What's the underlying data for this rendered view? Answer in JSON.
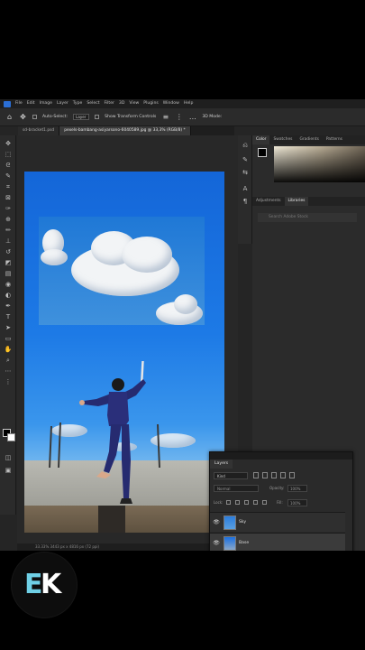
{
  "menubar": {
    "items": [
      "File",
      "Edit",
      "Image",
      "Layer",
      "Type",
      "Select",
      "Filter",
      "3D",
      "View",
      "Plugins",
      "Window",
      "Help"
    ]
  },
  "options_bar": {
    "auto_select_label": "Auto-Select:",
    "auto_select_value": "Layer",
    "transform_controls_label": "Show Transform Controls",
    "mode_3d_label": "3D Mode:"
  },
  "document_tabs": [
    {
      "label": "sd-bracket1.psd",
      "active": false
    },
    {
      "label": "pexels-bambang-asiyarsono-6040589.jpg @ 33,3% (RGB/8) *",
      "active": true
    }
  ],
  "canvas_status": "33.33%   3443 px x 4816 px (72 ppi)",
  "color_panel": {
    "tabs": [
      {
        "label": "Color",
        "active": true
      },
      {
        "label": "Swatches",
        "active": false
      },
      {
        "label": "Gradients",
        "active": false
      },
      {
        "label": "Patterns",
        "active": false
      }
    ],
    "foreground_color": "#000000"
  },
  "adjust_panel": {
    "tabs": [
      {
        "label": "Adjustments",
        "active": false
      },
      {
        "label": "Libraries",
        "active": true
      }
    ],
    "search_placeholder": "Search Adobe Stock"
  },
  "layers_panel": {
    "title": "Layers",
    "filter_label": "Kind",
    "blend_mode": "Normal",
    "opacity_label": "Opacity:",
    "opacity_value": "100%",
    "lock_label": "Lock:",
    "fill_label": "Fill:",
    "fill_value": "100%",
    "layers": [
      {
        "name": "Sky",
        "visible": true
      },
      {
        "name": "Base",
        "visible": true
      }
    ]
  },
  "channel_logo": {
    "letter1": "E",
    "letter2": "K",
    "color1": "#6fd0e6",
    "color2": "#ffffff"
  }
}
